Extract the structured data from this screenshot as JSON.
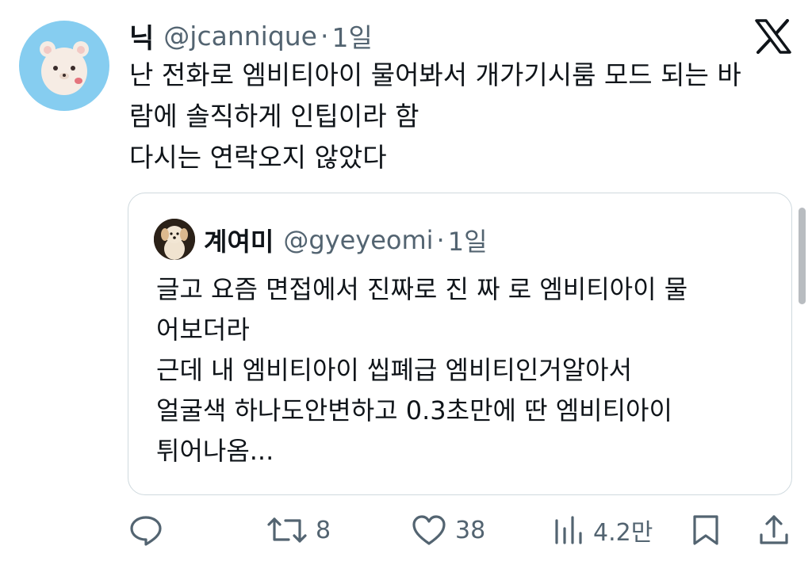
{
  "tweet": {
    "author_name": "닉",
    "handle": "@jcannique",
    "separator": "·",
    "time": "1일",
    "lines": [
      "난 전화로 엠비티아이 물어봐서 개가기시룸 모드 되는 바",
      "람에 솔직하게 인팁이라 함",
      "다시는 연락오지 않았다"
    ]
  },
  "quote": {
    "author_name": "계여미",
    "handle": "@gyeyeomi",
    "separator": "·",
    "time": "1일",
    "lines": [
      "글고 요즘 면접에서 진짜로 진 짜 로 엠비티아이 물",
      "어보더라",
      "근데 내 엠비티아이 씹폐급 엠비티인거알아서",
      "얼굴색 하나도안변하고 0.3초만에 딴 엠비티아이",
      "튀어나옴..."
    ]
  },
  "actions": {
    "reply": {
      "icon": "reply-icon",
      "count": ""
    },
    "retweet": {
      "icon": "retweet-icon",
      "count": "8"
    },
    "like": {
      "icon": "heart-icon",
      "count": "38"
    },
    "views": {
      "icon": "views-icon",
      "count": "4.2만"
    },
    "bookmark": {
      "icon": "bookmark-icon"
    },
    "share": {
      "icon": "share-icon"
    }
  },
  "colors": {
    "text": "#0f1419",
    "secondary": "#536471",
    "border": "#cfd9de",
    "avatar_bg": "#86cdf0"
  }
}
